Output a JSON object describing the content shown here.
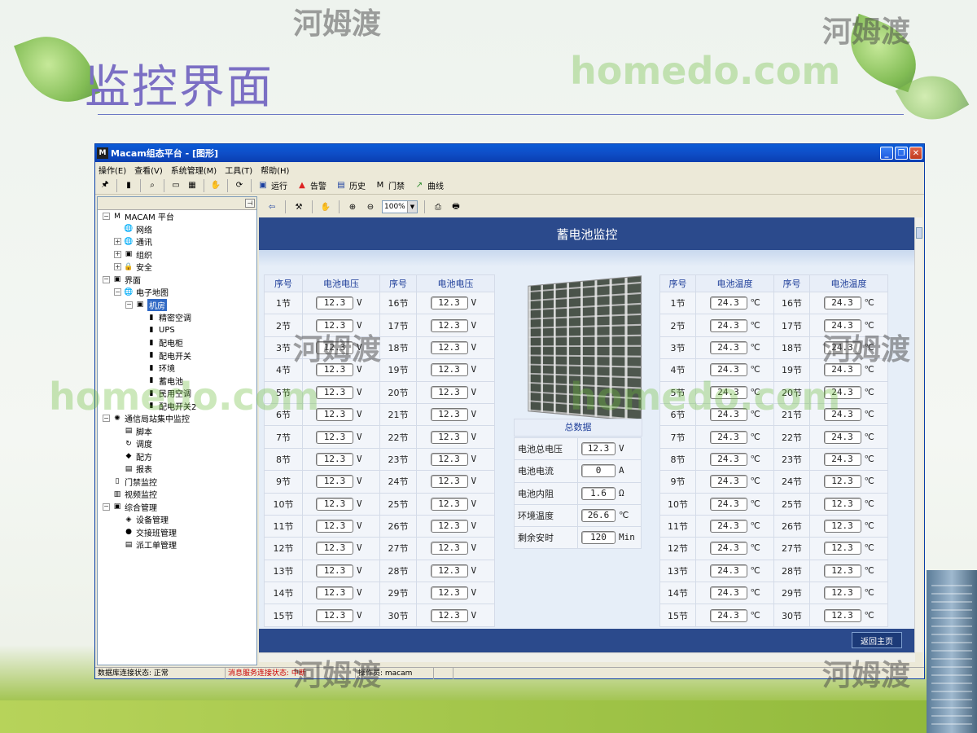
{
  "slide": {
    "title": "监控界面",
    "watermark_text_en": "homedo.com",
    "watermark_text_cn": "河姆渡"
  },
  "window": {
    "title": "Macam组态平台 - [图形]",
    "app_icon": "M",
    "menus": [
      "操作(E)",
      "查看(V)",
      "系统管理(M)",
      "工具(T)",
      "帮助(H)"
    ],
    "toolbar_buttons": [
      "运行",
      "告警",
      "历史",
      "门禁",
      "曲线"
    ],
    "zoom": "100%"
  },
  "tree": {
    "items": [
      {
        "label": "MACAM 平台",
        "level": 0,
        "expander": "−",
        "icon": "M"
      },
      {
        "label": "网络",
        "level": 1,
        "expander": "",
        "icon": "🌐"
      },
      {
        "label": "通讯",
        "level": 1,
        "expander": "+",
        "icon": "🌐"
      },
      {
        "label": "组织",
        "level": 1,
        "expander": "+",
        "icon": "▣"
      },
      {
        "label": "安全",
        "level": 1,
        "expander": "+",
        "icon": "🔒"
      },
      {
        "label": "界面",
        "level": 0,
        "expander": "−",
        "icon": "▣"
      },
      {
        "label": "电子地图",
        "level": 1,
        "expander": "−",
        "icon": "🌐"
      },
      {
        "label": "机房",
        "level": 2,
        "expander": "−",
        "icon": "▣",
        "selected": true
      },
      {
        "label": "精密空调",
        "level": 3,
        "expander": "",
        "icon": "▮"
      },
      {
        "label": "UPS",
        "level": 3,
        "expander": "",
        "icon": "▮"
      },
      {
        "label": "配电柜",
        "level": 3,
        "expander": "",
        "icon": "▮"
      },
      {
        "label": "配电开关",
        "level": 3,
        "expander": "",
        "icon": "▮"
      },
      {
        "label": "环境",
        "level": 3,
        "expander": "",
        "icon": "▮"
      },
      {
        "label": "蓄电池",
        "level": 3,
        "expander": "",
        "icon": "▮"
      },
      {
        "label": "民用空调",
        "level": 3,
        "expander": "",
        "icon": "▮"
      },
      {
        "label": "配电开关2",
        "level": 3,
        "expander": "",
        "icon": "▮"
      },
      {
        "label": "通信局站集中监控",
        "level": 0,
        "expander": "−",
        "icon": "✺"
      },
      {
        "label": "脚本",
        "level": 1,
        "expander": "",
        "icon": "▤"
      },
      {
        "label": "调度",
        "level": 1,
        "expander": "",
        "icon": "↻"
      },
      {
        "label": "配方",
        "level": 1,
        "expander": "",
        "icon": "◆"
      },
      {
        "label": "报表",
        "level": 1,
        "expander": "",
        "icon": "▤"
      },
      {
        "label": "门禁监控",
        "level": 0,
        "expander": "",
        "icon": "▯"
      },
      {
        "label": "视频监控",
        "level": 0,
        "expander": "",
        "icon": "▥"
      },
      {
        "label": "综合管理",
        "level": 0,
        "expander": "−",
        "icon": "▣"
      },
      {
        "label": "设备管理",
        "level": 1,
        "expander": "",
        "icon": "◈"
      },
      {
        "label": "交接班管理",
        "level": 1,
        "expander": "",
        "icon": "●"
      },
      {
        "label": "派工单管理",
        "level": 1,
        "expander": "",
        "icon": "▤"
      }
    ]
  },
  "panel": {
    "banner_title": "蓄电池监控",
    "return_button": "返回主页",
    "voltage_table": {
      "headers": [
        "序号",
        "电池电压",
        "序号",
        "电池电压"
      ],
      "unit": "V",
      "rows": [
        [
          "1节",
          "12.3",
          "16节",
          "12.3"
        ],
        [
          "2节",
          "12.3",
          "17节",
          "12.3"
        ],
        [
          "3节",
          "12.3",
          "18节",
          "12.3"
        ],
        [
          "4节",
          "12.3",
          "19节",
          "12.3"
        ],
        [
          "5节",
          "12.3",
          "20节",
          "12.3"
        ],
        [
          "6节",
          "12.3",
          "21节",
          "12.3"
        ],
        [
          "7节",
          "12.3",
          "22节",
          "12.3"
        ],
        [
          "8节",
          "12.3",
          "23节",
          "12.3"
        ],
        [
          "9节",
          "12.3",
          "24节",
          "12.3"
        ],
        [
          "10节",
          "12.3",
          "25节",
          "12.3"
        ],
        [
          "11节",
          "12.3",
          "26节",
          "12.3"
        ],
        [
          "12节",
          "12.3",
          "27节",
          "12.3"
        ],
        [
          "13节",
          "12.3",
          "28节",
          "12.3"
        ],
        [
          "14节",
          "12.3",
          "29节",
          "12.3"
        ],
        [
          "15节",
          "12.3",
          "30节",
          "12.3"
        ]
      ]
    },
    "temperature_table": {
      "headers": [
        "序号",
        "电池温度",
        "序号",
        "电池温度"
      ],
      "unit": "℃",
      "rows": [
        [
          "1节",
          "24.3",
          "16节",
          "24.3"
        ],
        [
          "2节",
          "24.3",
          "17节",
          "24.3"
        ],
        [
          "3节",
          "24.3",
          "18节",
          "24.3"
        ],
        [
          "4节",
          "24.3",
          "19节",
          "24.3"
        ],
        [
          "5节",
          "24.3",
          "20节",
          "24.3"
        ],
        [
          "6节",
          "24.3",
          "21节",
          "24.3"
        ],
        [
          "7节",
          "24.3",
          "22节",
          "24.3"
        ],
        [
          "8节",
          "24.3",
          "23节",
          "24.3"
        ],
        [
          "9节",
          "24.3",
          "24节",
          "12.3"
        ],
        [
          "10节",
          "24.3",
          "25节",
          "12.3"
        ],
        [
          "11节",
          "24.3",
          "26节",
          "12.3"
        ],
        [
          "12节",
          "24.3",
          "27节",
          "12.3"
        ],
        [
          "13节",
          "24.3",
          "28节",
          "12.3"
        ],
        [
          "14节",
          "24.3",
          "29节",
          "12.3"
        ],
        [
          "15节",
          "24.3",
          "30节",
          "12.3"
        ]
      ]
    },
    "summary": {
      "title": "总数据",
      "rows": [
        {
          "label": "电池总电压",
          "value": "12.3",
          "unit": "V"
        },
        {
          "label": "电池电流",
          "value": "0",
          "unit": "A"
        },
        {
          "label": "电池内阻",
          "value": "1.6",
          "unit": "Ω"
        },
        {
          "label": "环境温度",
          "value": "26.6",
          "unit": "℃"
        },
        {
          "label": "剩余安时",
          "value": "120",
          "unit": "Min"
        }
      ]
    }
  },
  "status_bar": {
    "db_status": "数据库连接状态: 正常",
    "msg_status": "消息服务连接状态: 中断",
    "operator": "操作员: macam",
    "empty": ""
  },
  "colors": {
    "banner": "#2b4a8c",
    "header_text": "#1f3f9a",
    "slide_title": "#7b6fc4",
    "status_alert": "#cc0000"
  }
}
